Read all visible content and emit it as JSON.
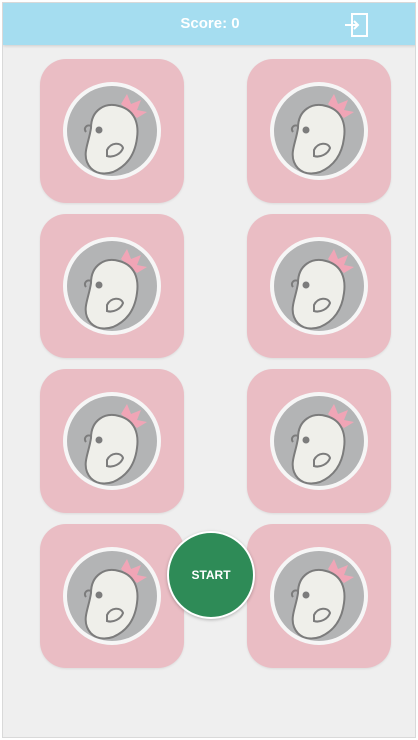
{
  "colors": {
    "topbar": "#a5ddf0",
    "card": "#eabdc4",
    "start_button": "#2e8b57",
    "background": "#efefef",
    "emblem_circle": "#b3b4b5",
    "emblem_ring": "#f6f6f6",
    "bird_body": "#efefea",
    "bird_crest": "#f0a5b6"
  },
  "header": {
    "score_label": "Score: ",
    "score_value": "0",
    "exit_icon": "exit-door-icon"
  },
  "board": {
    "card_back_icon": "bird-emblem-icon",
    "cards": [
      {
        "state": "face-down"
      },
      {
        "state": "face-down"
      },
      {
        "state": "face-down"
      },
      {
        "state": "face-down"
      },
      {
        "state": "face-down"
      },
      {
        "state": "face-down"
      },
      {
        "state": "face-down"
      },
      {
        "state": "face-down"
      }
    ]
  },
  "start_button": {
    "label": "START"
  }
}
